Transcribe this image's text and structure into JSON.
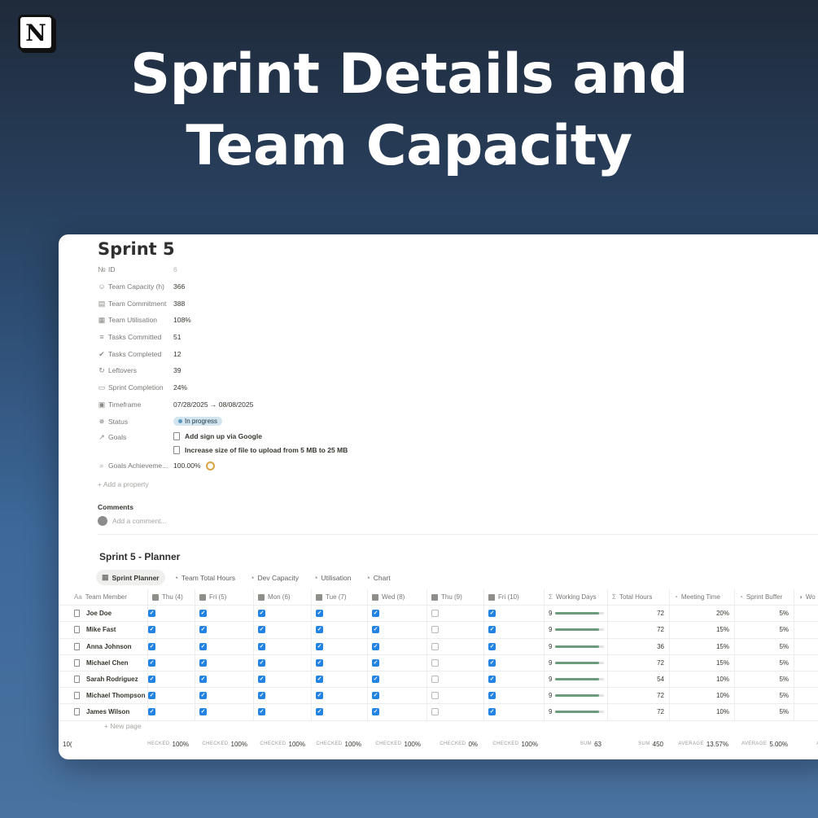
{
  "logo": {
    "glyph": "N"
  },
  "hero": {
    "line1": "Sprint Details and",
    "line2": "Team Capacity"
  },
  "page": {
    "title": "Sprint 5"
  },
  "properties": [
    {
      "icon": "№",
      "name": "ID",
      "value": "6",
      "muted": true
    },
    {
      "icon": "☺",
      "name": "Team Capacity (h)",
      "value": "366"
    },
    {
      "icon": "▤",
      "name": "Team Commitment",
      "value": "388"
    },
    {
      "icon": "▦",
      "name": "Team Utilisation",
      "value": "108%"
    },
    {
      "icon": "≡",
      "name": "Tasks Committed",
      "value": "51"
    },
    {
      "icon": "✔",
      "name": "Tasks Completed",
      "value": "12"
    },
    {
      "icon": "↻",
      "name": "Leftovers",
      "value": "39"
    },
    {
      "icon": "▭",
      "name": "Sprint Completion",
      "value": "24%"
    },
    {
      "icon": "▣",
      "name": "Timeframe",
      "value": "07/28/2025 → 08/08/2025"
    }
  ],
  "status": {
    "icon": "✵",
    "name": "Status",
    "value": "In progress"
  },
  "goals": {
    "icon": "↗",
    "name": "Goals",
    "items": [
      "Add sign up via Google",
      "Increase size of file to upload from 5 MB to 25 MB"
    ]
  },
  "goals_achievement": {
    "icon": "⌕",
    "name": "Goals Achieveme...",
    "value": "100.00%"
  },
  "add_property": "+ Add a property",
  "comments": {
    "heading": "Comments",
    "placeholder": "Add a comment..."
  },
  "database": {
    "title": "Sprint 5 - Planner",
    "views": [
      {
        "icon": "▦",
        "label": "Sprint Planner",
        "active": true
      },
      {
        "icon": "◔",
        "label": "Team Total Hours"
      },
      {
        "icon": "◔",
        "label": "Dev Capacity"
      },
      {
        "icon": "◔",
        "label": "Utilisation"
      },
      {
        "icon": "◔",
        "label": "Chart"
      }
    ],
    "columns": [
      {
        "icon": "Aa",
        "label": "Team Member"
      },
      {
        "icon": "",
        "label": "Thu (4)"
      },
      {
        "icon": "",
        "label": "Fri (5)"
      },
      {
        "icon": "",
        "label": "Mon (6)"
      },
      {
        "icon": "",
        "label": "Tue (7)"
      },
      {
        "icon": "",
        "label": "Wed (8)"
      },
      {
        "icon": "",
        "label": "Thu (9)"
      },
      {
        "icon": "",
        "label": "Fri (10)"
      },
      {
        "icon": "Σ",
        "label": "Working Days"
      },
      {
        "icon": "Σ",
        "label": "Total Hours"
      },
      {
        "icon": "◔",
        "label": "Meeting Time"
      },
      {
        "icon": "◔",
        "label": "Sprint Buffer"
      },
      {
        "icon": "◑",
        "label": "Wo"
      }
    ],
    "rows": [
      {
        "name": "Joe Doe",
        "days": [
          true,
          true,
          true,
          true,
          true,
          false,
          true
        ],
        "working_days": "9",
        "progress": 0.9,
        "total_hours": "72",
        "meeting": "20%",
        "buffer": "5%"
      },
      {
        "name": "Mike Fast",
        "days": [
          true,
          true,
          true,
          true,
          true,
          false,
          true
        ],
        "working_days": "9",
        "progress": 0.9,
        "total_hours": "72",
        "meeting": "15%",
        "buffer": "5%"
      },
      {
        "name": "Anna Johnson",
        "days": [
          true,
          true,
          true,
          true,
          true,
          false,
          true
        ],
        "working_days": "9",
        "progress": 0.9,
        "total_hours": "36",
        "meeting": "15%",
        "buffer": "5%"
      },
      {
        "name": "Michael Chen",
        "days": [
          true,
          true,
          true,
          true,
          true,
          false,
          true
        ],
        "working_days": "9",
        "progress": 0.9,
        "total_hours": "72",
        "meeting": "15%",
        "buffer": "5%"
      },
      {
        "name": "Sarah Rodriguez",
        "days": [
          true,
          true,
          true,
          true,
          true,
          false,
          true
        ],
        "working_days": "9",
        "progress": 0.9,
        "total_hours": "54",
        "meeting": "10%",
        "buffer": "5%"
      },
      {
        "name": "Michael Thompson",
        "days": [
          true,
          true,
          true,
          true,
          true,
          false,
          true
        ],
        "working_days": "9",
        "progress": 0.9,
        "total_hours": "72",
        "meeting": "10%",
        "buffer": "5%"
      },
      {
        "name": "James Wilson",
        "days": [
          true,
          true,
          true,
          true,
          true,
          false,
          true
        ],
        "working_days": "9",
        "progress": 0.9,
        "total_hours": "72",
        "meeting": "10%",
        "buffer": "5%"
      }
    ],
    "new_page": "+ New page",
    "footer": [
      {
        "label": "",
        "value": "10("
      },
      {
        "label": "HECKED",
        "value": "100%"
      },
      {
        "label": "CHECKED",
        "value": "100%"
      },
      {
        "label": "CHECKED",
        "value": "100%"
      },
      {
        "label": "CHECKED",
        "value": "100%"
      },
      {
        "label": "CHECKED",
        "value": "100%"
      },
      {
        "label": "CHECKED",
        "value": "0%"
      },
      {
        "label": "CHECKED",
        "value": "100%"
      },
      {
        "label": "SUM",
        "value": "63"
      },
      {
        "label": "SUM",
        "value": "450"
      },
      {
        "label": "AVERAGE",
        "value": "13.57%"
      },
      {
        "label": "AVERAGE",
        "value": "5.00%"
      },
      {
        "label": "AVERA",
        "value": ""
      }
    ]
  },
  "colors": {
    "checkbox": "#2383e2",
    "progress": "#6c9a7c",
    "status_badge": "#d3e5ef"
  }
}
